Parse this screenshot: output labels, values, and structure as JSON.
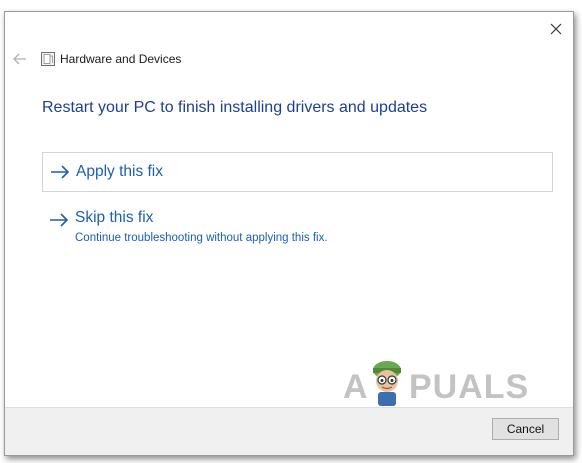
{
  "window": {
    "title": "Hardware and Devices",
    "back_icon": "back-arrow-icon",
    "app_icon": "troubleshooter-icon",
    "close_icon": "close-icon"
  },
  "main": {
    "heading": "Restart your PC to finish installing drivers and updates",
    "apply_option": {
      "label": "Apply this fix",
      "icon": "right-arrow-icon"
    },
    "skip_option": {
      "label": "Skip this fix",
      "description": "Continue troubleshooting without applying this fix.",
      "icon": "right-arrow-icon"
    }
  },
  "watermark": {
    "text_left": "A",
    "text_right": "PUALS"
  },
  "footer": {
    "cancel_label": "Cancel"
  },
  "colors": {
    "heading": "#1c3f94",
    "link": "#1a5fb4",
    "footer_bg": "#f0f0f0",
    "watermark": "#c3c3c3"
  }
}
